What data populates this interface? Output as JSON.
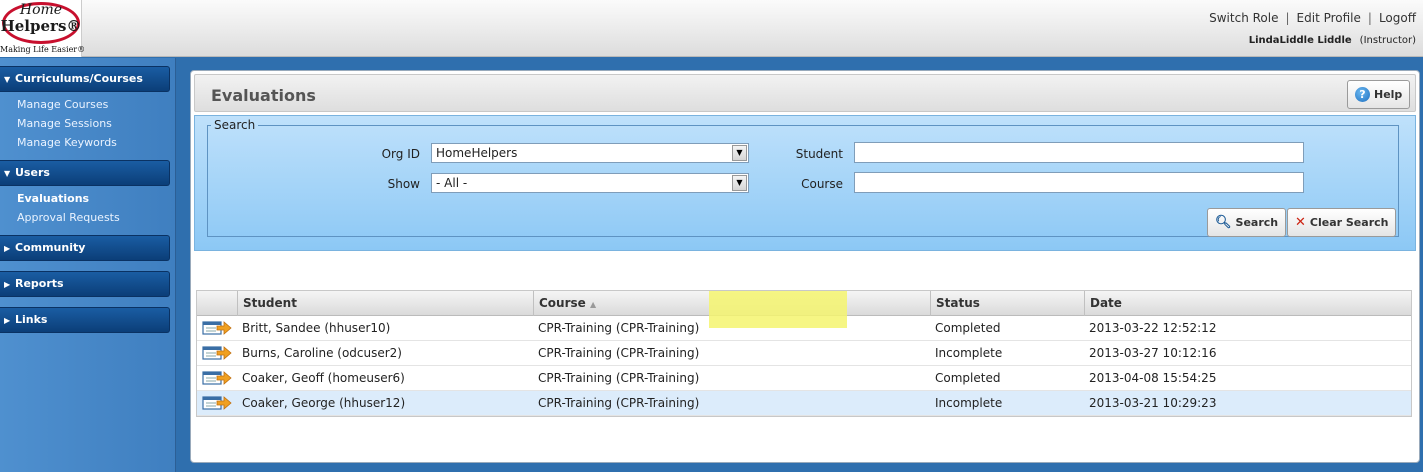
{
  "header": {
    "logo": {
      "line1": "Home",
      "line2": "Helpers®",
      "tagline": "Making Life Easier®"
    },
    "links": [
      "Switch Role",
      "Edit Profile",
      "Logoff"
    ],
    "user": {
      "name": "LindaLiddle Liddle",
      "role": "(Instructor)"
    }
  },
  "sidebar": {
    "sections": [
      {
        "label": "Curriculums/Courses",
        "expanded": true
      },
      {
        "label": "Users",
        "expanded": true
      },
      {
        "label": "Community",
        "expanded": false
      },
      {
        "label": "Reports",
        "expanded": false
      },
      {
        "label": "Links",
        "expanded": false
      }
    ],
    "courses_links": [
      "Manage Courses",
      "Manage Sessions",
      "Manage Keywords"
    ],
    "users_links": [
      "Evaluations",
      "Approval Requests"
    ],
    "active_link": "Evaluations"
  },
  "page": {
    "title": "Evaluations",
    "help_label": "Help"
  },
  "search": {
    "legend": "Search",
    "org_label": "Org ID",
    "org_value": "HomeHelpers",
    "show_label": "Show",
    "show_value": "- All -",
    "student_label": "Student",
    "student_value": "",
    "course_label": "Course",
    "course_value": "",
    "search_button": "Search",
    "clear_button": "Clear Search"
  },
  "grid": {
    "columns": [
      "",
      "Student",
      "Course",
      "Status",
      "Date"
    ],
    "sort_indicator": "▲",
    "rows": [
      {
        "student": "Britt, Sandee (hhuser10)",
        "course": "CPR-Training (CPR-Training)",
        "status": "Completed",
        "date": "2013-03-22 12:52:12"
      },
      {
        "student": "Burns, Caroline (odcuser2)",
        "course": "CPR-Training (CPR-Training)",
        "status": "Incomplete",
        "date": "2013-03-27 10:12:16"
      },
      {
        "student": "Coaker, Geoff (homeuser6)",
        "course": "CPR-Training (CPR-Training)",
        "status": "Completed",
        "date": "2013-04-08 15:54:25"
      },
      {
        "student": "Coaker, George (hhuser12)",
        "course": "CPR-Training (CPR-Training)",
        "status": "Incomplete",
        "date": "2013-03-21 10:29:23"
      }
    ]
  },
  "colors": {
    "highlight": "#f4f56e",
    "sidebar_head": "#0b3e78",
    "selected_row": "#dcecfb"
  }
}
